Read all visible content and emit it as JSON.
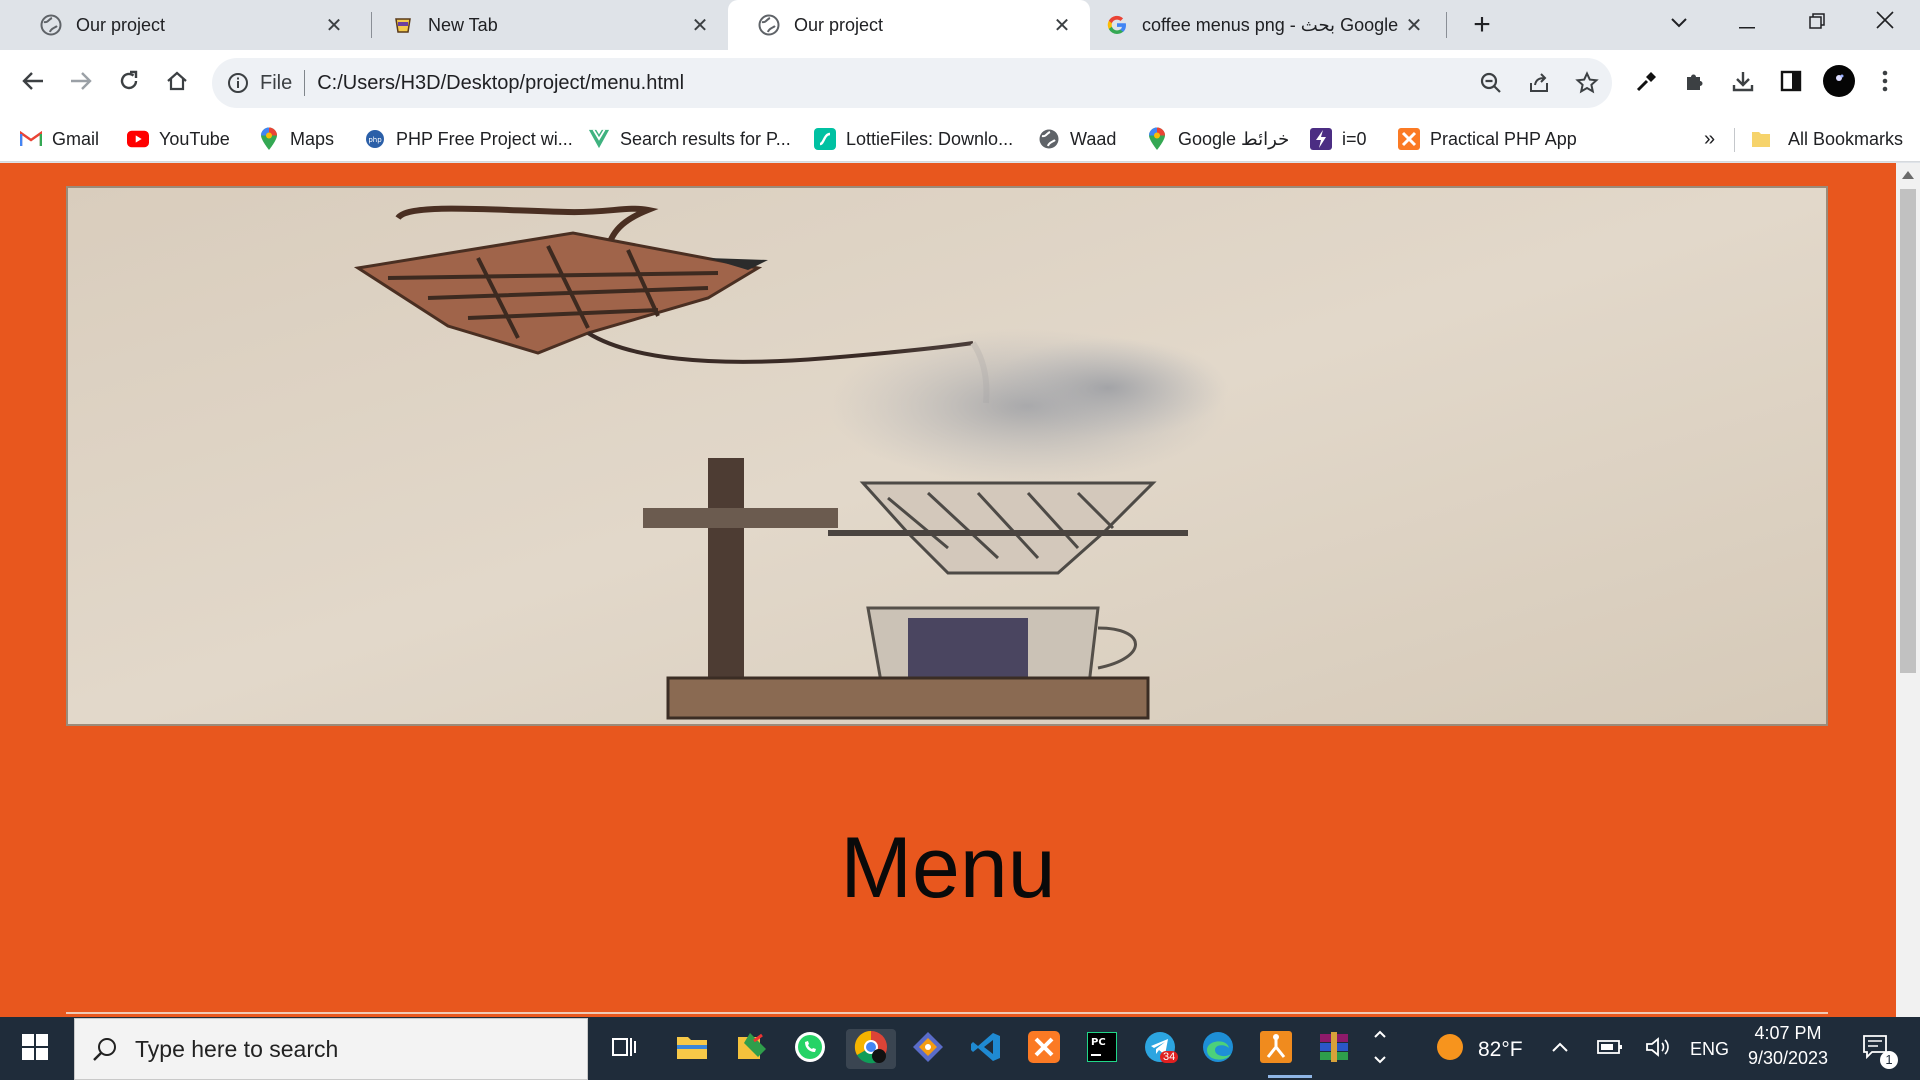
{
  "tabs": [
    {
      "title": "Our project",
      "icon": "globe-icon",
      "active": false
    },
    {
      "title": "New Tab",
      "icon": "cup-icon",
      "active": false
    },
    {
      "title": "Our project",
      "icon": "globe-icon",
      "active": true
    },
    {
      "title": "coffee menus png - بحث Google",
      "icon": "google-icon",
      "active": false
    }
  ],
  "address": {
    "scheme": "File",
    "url": "C:/Users/H3D/Desktop/project/menu.html"
  },
  "bookmarks": [
    {
      "label": "Gmail",
      "icon": "gmail-icon"
    },
    {
      "label": "YouTube",
      "icon": "youtube-icon"
    },
    {
      "label": "Maps",
      "icon": "maps-pin-icon"
    },
    {
      "label": "PHP Free Project wi...",
      "icon": "php-icon"
    },
    {
      "label": "Search results for P...",
      "icon": "vue-icon"
    },
    {
      "label": "LottieFiles: Downlo...",
      "icon": "lottie-icon"
    },
    {
      "label": "Waad",
      "icon": "globe-icon"
    },
    {
      "label": "Google خرائط",
      "icon": "maps-pin-icon"
    },
    {
      "label": "i=0",
      "icon": "bolt-icon"
    },
    {
      "label": "Practical PHP App",
      "icon": "xampp-icon"
    }
  ],
  "bookmarks_overflow": "»",
  "all_bookmarks": "All Bookmarks",
  "page": {
    "heading": "Menu",
    "background_color": "#e8571e"
  },
  "taskbar": {
    "search_placeholder": "Type here to search",
    "temperature": "82°F",
    "language": "ENG",
    "time": "4:07 PM",
    "date": "9/30/2023",
    "notification_count": "1",
    "telegram_badge": "34"
  }
}
